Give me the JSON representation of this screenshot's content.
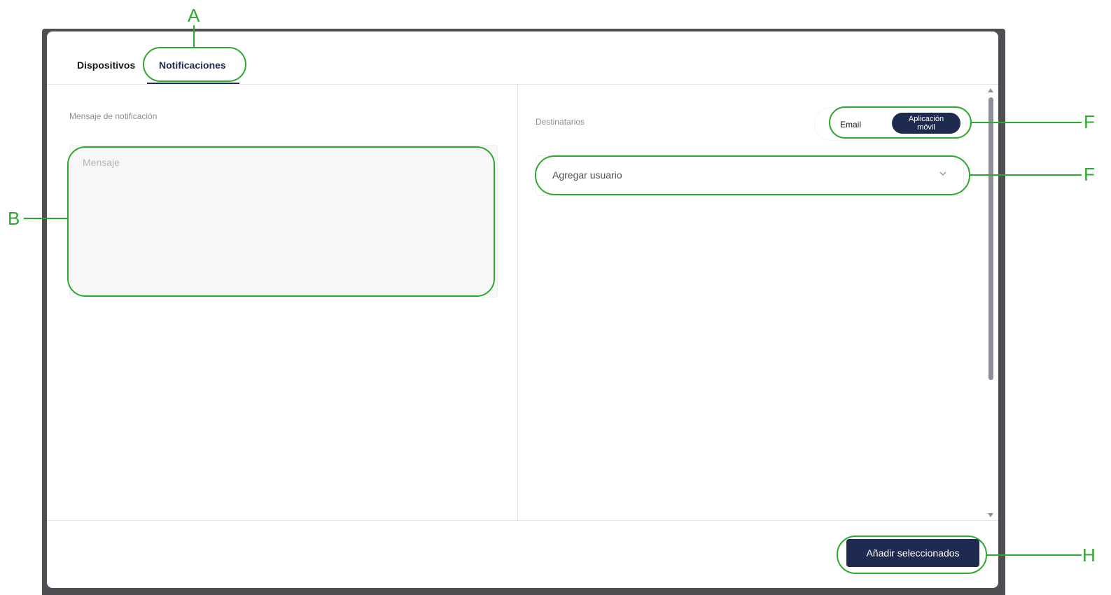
{
  "tabs": [
    {
      "label": "Dispositivos"
    },
    {
      "label": "Notificaciones"
    }
  ],
  "message_section": {
    "label": "Mensaje de notificación",
    "placeholder": "Mensaje"
  },
  "recipients_section": {
    "label": "Destinatarios",
    "toggle": {
      "option_email": "Email",
      "option_app_line1": "Aplicación",
      "option_app_line2": "móvil",
      "selected": "Aplicación móvil"
    },
    "add_user_placeholder": "Agregar usuario"
  },
  "footer": {
    "primary_button": "Añadir seleccionados"
  },
  "annotations": {
    "tab": "A",
    "message": "B",
    "toggle": "F",
    "user_select": "F",
    "button": "H"
  },
  "colors": {
    "accent": "#1e2a4f",
    "annotation": "#2ea82e",
    "backdrop": "#4d4f52"
  }
}
